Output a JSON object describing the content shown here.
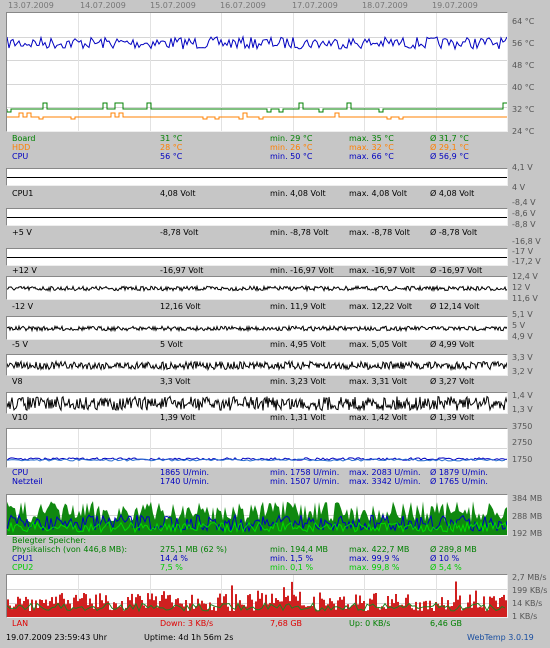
{
  "dates": [
    "13.07.2009",
    "14.07.2009",
    "15.07.2009",
    "16.07.2009",
    "17.07.2009",
    "18.07.2009",
    "19.07.2009"
  ],
  "colors": {
    "blue": "#0000c0",
    "green": "#008000",
    "orange": "#ff8000",
    "red": "#e00000",
    "black": "#000000",
    "fill_green": "#108810",
    "fill_red": "#d02020"
  },
  "temp": {
    "scale": [
      "64 °C",
      "56 °C",
      "48 °C",
      "40 °C",
      "32 °C",
      "24 °C"
    ],
    "rows": [
      {
        "label": "Board",
        "value": "31 °C",
        "min": "min. 29 °C",
        "max": "max. 35 °C",
        "avg": "Ø 31,7 °C",
        "color": "#008000"
      },
      {
        "label": "HDD",
        "value": "28 °C",
        "min": "min. 26 °C",
        "max": "max. 32 °C",
        "avg": "Ø 29,1 °C",
        "color": "#ff8000"
      },
      {
        "label": "CPU",
        "value": "56 °C",
        "min": "min. 50 °C",
        "max": "max. 66 °C",
        "avg": "Ø 56,9 °C",
        "color": "#0000c0"
      }
    ]
  },
  "volt": [
    {
      "label": "CPU1",
      "value": "4,08 Volt",
      "min": "min. 4,08 Volt",
      "max": "max. 4,08 Volt",
      "avg": "Ø 4,08 Volt",
      "scale": [
        "4,1 V",
        "4 V"
      ]
    },
    {
      "label": "+5 V",
      "value": "-8,78 Volt",
      "min": "min. -8,78 Volt",
      "max": "max. -8,78 Volt",
      "avg": "Ø -8,78 Volt",
      "scale": [
        "-8,4 V",
        "-8,6 V",
        "-8,8 V"
      ]
    },
    {
      "label": "+12 V",
      "value": "-16,97 Volt",
      "min": "min. -16,97 Volt",
      "max": "max. -16,97 Volt",
      "avg": "Ø -16,97 Volt",
      "scale": [
        "-16,8 V",
        "-17 V",
        "-17,2 V"
      ]
    },
    {
      "label": "-12 V",
      "value": "12,16 Volt",
      "min": "min. 11,9 Volt",
      "max": "max. 12,22 Volt",
      "avg": "Ø 12,14 Volt",
      "scale": [
        "12,4 V",
        "12 V",
        "11,6 V"
      ]
    },
    {
      "label": "-5 V",
      "value": "5 Volt",
      "min": "min. 4,95 Volt",
      "max": "max. 5,05 Volt",
      "avg": "Ø 4,99 Volt",
      "scale": [
        "5,1 V",
        "5 V",
        "4,9 V"
      ]
    },
    {
      "label": "V8",
      "value": "3,3 Volt",
      "min": "min. 3,23 Volt",
      "max": "max. 3,31 Volt",
      "avg": "Ø 3,27 Volt",
      "scale": [
        "3,3 V",
        "3,2 V"
      ]
    },
    {
      "label": "V10",
      "value": "1,39 Volt",
      "min": "min. 1,31 Volt",
      "max": "max. 1,42 Volt",
      "avg": "Ø 1,39 Volt",
      "scale": [
        "1,4 V",
        "1,3 V"
      ]
    }
  ],
  "fan": {
    "scale": [
      "3750",
      "2750",
      "1750"
    ],
    "rows": [
      {
        "label": "CPU",
        "value": "1865 U/min.",
        "min": "min. 1758 U/min.",
        "max": "max. 2083 U/min.",
        "avg": "Ø 1879 U/min.",
        "color": "#0000c0"
      },
      {
        "label": "Netzteil",
        "value": "1740 U/min.",
        "min": "min. 1507 U/min.",
        "max": "max. 3342 U/min.",
        "avg": "Ø 1765 U/min.",
        "color": "#0000c0"
      }
    ]
  },
  "mem": {
    "scale": [
      "384 MB",
      "288 MB",
      "192 MB"
    ],
    "header": "Belegter Speicher:",
    "rows": [
      {
        "label": "Physikalisch (von 446,8 MB):",
        "value": "275,1 MB (62 %)",
        "min": "min. 194,4 MB",
        "max": "max. 422,7 MB",
        "avg": "Ø 289,8 MB",
        "color": "#008000"
      },
      {
        "label": "CPU1",
        "value": "14,4 %",
        "min": "min. 1,5 %",
        "max": "max. 99,9 %",
        "avg": "Ø 10 %",
        "color": "#0000c0"
      },
      {
        "label": "CPU2",
        "value": "7,5 %",
        "min": "min. 0,1 %",
        "max": "max. 99,8 %",
        "avg": "Ø 5,4 %",
        "color": "#00cc00"
      }
    ]
  },
  "lan": {
    "scale": [
      "2,7 MB/s",
      "199 KB/s",
      "14 KB/s",
      "1 KB/s"
    ],
    "label": "LAN",
    "down": "Down: 3 KB/s",
    "down_total": "7,68 GB",
    "up": "Up: 0 KB/s",
    "up_total": "6,46 GB"
  },
  "footer": {
    "timestamp": "19.07.2009 23:59:43 Uhr",
    "uptime": "Uptime: 4d 1h 56m 2s",
    "app": "WebTemp 3.0.19"
  }
}
